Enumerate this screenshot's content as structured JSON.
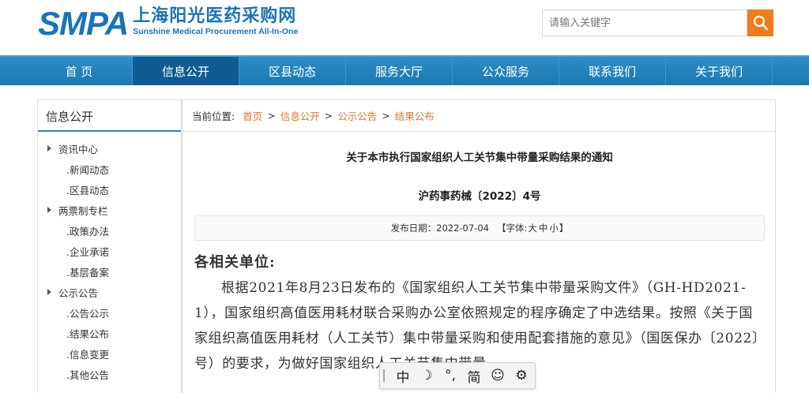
{
  "header": {
    "logo_mark": "SMPA",
    "logo_cn": "上海阳光医药采购网",
    "logo_en": "Sunshine Medical Procurement All-In-One",
    "search_placeholder": "请输入关键字",
    "search_icon": "magnifier-icon",
    "accent_color": "#f07c1c",
    "brand_color": "#1a73b8"
  },
  "nav": {
    "items": [
      "首 页",
      "信息公开",
      "区县动态",
      "服务大厅",
      "公众服务",
      "联系我们",
      "关于我们"
    ],
    "active": "信息公开"
  },
  "sidebar": {
    "title": "信息公开",
    "sections": [
      {
        "label": "资讯中心",
        "items": [
          ".新闻动态",
          ".区县动态"
        ]
      },
      {
        "label": "两票制专栏",
        "items": [
          ".政策办法",
          ".企业承诺",
          ".基层备案"
        ]
      },
      {
        "label": "公示公告",
        "items": [
          ".公告公示",
          ".结果公布",
          ".信息变更",
          ".其他公告"
        ]
      }
    ]
  },
  "breadcrumb": {
    "prefix": "当前位置:",
    "items": [
      "首页",
      "信息公开",
      "公示公告",
      "结果公布"
    ],
    "separator": ">"
  },
  "article": {
    "title": "关于本市执行国家组织人工关节集中带量采购结果的通知",
    "doc_number": "沪药事药械〔2022〕4号",
    "date_label": "发布日期：",
    "date": "2022-07-04",
    "font_prefix": "【字体:",
    "font_large": "大",
    "font_medium": "中",
    "font_small": "小",
    "font_suffix": "】",
    "salutation": "各相关单位:",
    "paragraph": "根据2021年8月23日发布的《国家组织人工关节集中带量采购文件》（GH-HD2021-1），国家组织高值医用耗材联合采购办公室依照规定的程序确定了中选结果。按照《关于国家组织高值医用耗材（人工关节）集中带量采购和使用配套措施的意见》（国医保办〔2022〕号）的要求，为做好国家组织人工关节集中带量"
  },
  "ime": {
    "items": [
      "中",
      "☽",
      "°,",
      "简",
      "☺",
      "⚙"
    ],
    "names": [
      "ime-chinese-mode",
      "moon-icon",
      "punctuation-icon",
      "simplified-mode",
      "emoji-icon",
      "gear-icon"
    ]
  }
}
